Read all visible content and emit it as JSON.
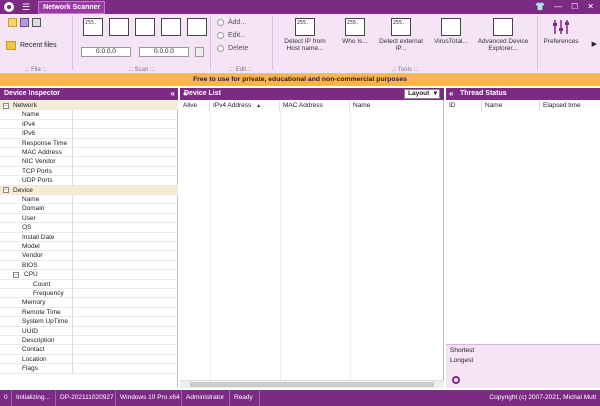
{
  "window": {
    "title": "Network Scanner",
    "menu_icon": "hamburger-icon",
    "controls": [
      "shirt-icon",
      "minimize-icon",
      "maximize-icon",
      "close-icon"
    ]
  },
  "ribbon": {
    "file": {
      "recent_label": "Recent files",
      "group_label": ".:: File ::."
    },
    "scan": {
      "ip_from": "0.0.0.0",
      "ip_to": "0.0.0.0",
      "group_label": ".:: Scan ::."
    },
    "edit": {
      "add": "Add...",
      "edit": "Edit...",
      "delete": "Delete",
      "group_label": ".:: Edit ::."
    },
    "tools": {
      "detect_ip": "Detect IP from Host name...",
      "whois": "Who Is...",
      "detect_external": "Detect external IP...",
      "virustotal": "VirusTotal...",
      "adv_explorer": "Advanced Device Explorer...",
      "group_label": ".:: Tools ::."
    },
    "preferences": "Preferences"
  },
  "banner": "Free to use for private, educational and non-commercial purposes",
  "inspector": {
    "title": "Device Inspector",
    "network_group": "Network",
    "network_items": [
      "Name",
      "IPv4",
      "IPv6",
      "Response Time",
      "MAC Address",
      "NIC Vendor",
      "TCP Ports",
      "UDP Ports"
    ],
    "device_group": "Device",
    "device_items": [
      "Name",
      "Domain",
      "User",
      "OS",
      "Install Date",
      "Model",
      "Vendor",
      "BIOS"
    ],
    "cpu_label": "CPU",
    "cpu_items": [
      "Count",
      "Frequency"
    ],
    "device_items2": [
      "Memory",
      "Remote Time",
      "System UpTime",
      "UUID",
      "Description",
      "Contact",
      "Location",
      "Flags"
    ]
  },
  "device_list": {
    "title": "Device List",
    "layout_label": "Layout",
    "columns": [
      "Alive",
      "IPv4 Address",
      "MAC Address",
      "Name"
    ]
  },
  "thread_status": {
    "title": "Thread Status",
    "columns": [
      "ID",
      "Name",
      "Elapsed time"
    ],
    "shortest_label": "Shortest",
    "longest_label": "Longest"
  },
  "status": {
    "count": "0",
    "state": "Initializing...",
    "host": "DP-202111020927",
    "os": "Windows 10 Pro x64",
    "role": "Administrator",
    "ready": "Ready",
    "copyright": "Copyright (c) 2007-2021, Michal Mutl"
  }
}
